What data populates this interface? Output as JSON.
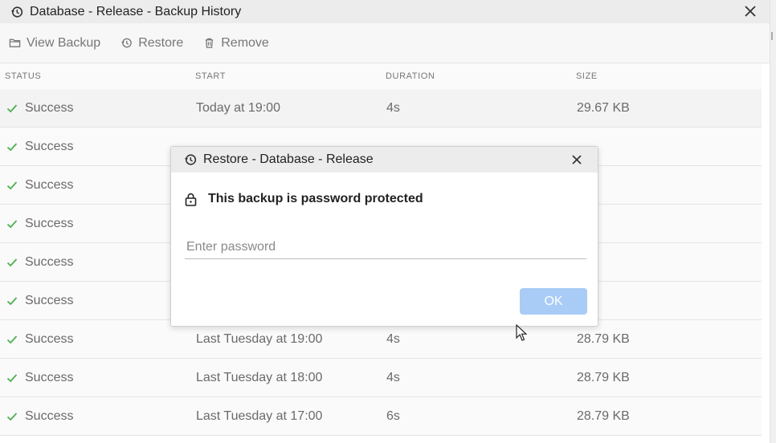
{
  "window": {
    "title": "Database - Release - Backup History"
  },
  "toolbar": {
    "view_label": "View Backup",
    "restore_label": "Restore",
    "remove_label": "Remove"
  },
  "table": {
    "headers": {
      "status": "STATUS",
      "start": "START",
      "duration": "DURATION",
      "size": "SIZE"
    },
    "rows": [
      {
        "status": "Success",
        "start": "Today at 19:00",
        "duration": "4s",
        "size": "29.67 KB"
      },
      {
        "status": "Success",
        "start": "",
        "duration": "",
        "size": ""
      },
      {
        "status": "Success",
        "start": "",
        "duration": "",
        "size": ""
      },
      {
        "status": "Success",
        "start": "",
        "duration": "",
        "size": ""
      },
      {
        "status": "Success",
        "start": "",
        "duration": "",
        "size": ""
      },
      {
        "status": "Success",
        "start": "",
        "duration": "",
        "size": ""
      },
      {
        "status": "Success",
        "start": "Last Tuesday at 19:00",
        "duration": "4s",
        "size": "28.79 KB"
      },
      {
        "status": "Success",
        "start": "Last Tuesday at 18:00",
        "duration": "4s",
        "size": "28.79 KB"
      },
      {
        "status": "Success",
        "start": "Last Tuesday at 17:00",
        "duration": "6s",
        "size": "28.79 KB"
      }
    ]
  },
  "dialog": {
    "title": "Restore - Database - Release",
    "message": "This backup is password protected",
    "password_placeholder": "Enter password",
    "ok_label": "OK"
  },
  "colors": {
    "success": "#4caf50",
    "ok_button": "#a9ccf6"
  }
}
